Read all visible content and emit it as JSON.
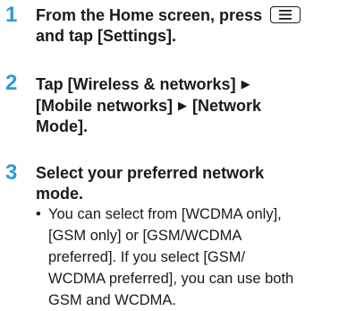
{
  "steps": [
    {
      "number": "1",
      "line1_prefix": "From the Home screen, press",
      "menu_key_icon": "menu-key-icon",
      "line2": "and tap [Settings]."
    },
    {
      "number": "2",
      "line1_a": "Tap [Wireless & networks]",
      "arrow": "▶",
      "line2_a": "[Mobile networks]",
      "line2_b": "[Network",
      "line3": "Mode]."
    },
    {
      "number": "3",
      "line1": "Select your preferred network",
      "line2": "mode.",
      "bullet": "•",
      "note_lines": [
        "You can select from [WCDMA only],",
        "[GSM only] or [GSM/WCDMA",
        "preferred]. If you select [GSM/",
        "WCDMA preferred], you can use both",
        "GSM and WCDMA."
      ]
    }
  ],
  "colors": {
    "step_number": "#2b9bd6",
    "text": "#1a1a1a"
  }
}
